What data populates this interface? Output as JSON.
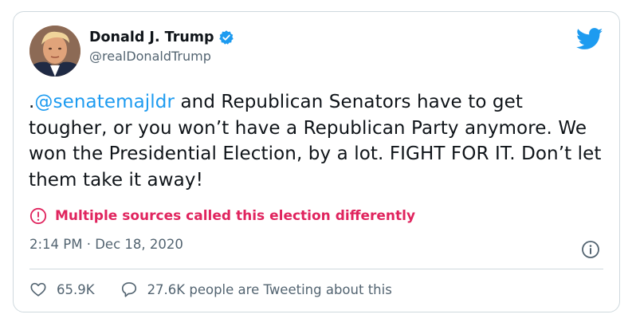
{
  "tweet": {
    "author_name": "Donald J. Trump",
    "handle": "@realDonaldTrump",
    "text_prefix": ".",
    "mention": "@senatemajldr",
    "text_rest": " and Republican Senators have to get tougher, or you won’t have a Republican Party anymore. We won the Presidential Election, by a lot. FIGHT FOR IT. Don’t let them take it away!",
    "warning": "Multiple sources called this election differently",
    "timestamp": "2:14 PM · Dec 18, 2020",
    "likes": "65.9K",
    "tweeting_about": "27.6K people are Tweeting about this"
  },
  "icons": {
    "verified": "verified-badge-icon",
    "brand": "twitter-bird-icon",
    "warning": "exclamation-circle-icon",
    "info": "info-circle-icon",
    "like": "heart-icon",
    "reply": "speech-bubble-icon"
  },
  "colors": {
    "mention": "#1d9bf0",
    "warning": "#e0245e",
    "muted": "#536471",
    "verified": "#1d9bf0",
    "twitter_brand": "#1d9bf0"
  }
}
